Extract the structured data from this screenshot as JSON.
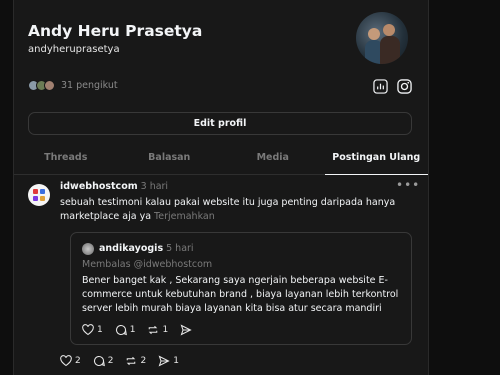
{
  "profile": {
    "name": "Andy Heru Prasetya",
    "handle": "andyheruprasetya",
    "followers": "31 pengikut",
    "edit_label": "Edit profil"
  },
  "tabs": [
    {
      "label": "Threads",
      "active": false
    },
    {
      "label": "Balasan",
      "active": false
    },
    {
      "label": "Media",
      "active": false
    },
    {
      "label": "Postingan Ulang",
      "active": true
    }
  ],
  "post": {
    "username": "idwebhostcom",
    "time": "3 hari",
    "text": "sebuah testimoni kalau pakai website itu juga penting daripada hanya marketplace aja ya",
    "translate": "Terjemahkan",
    "actions": {
      "likes": "2",
      "comments": "2",
      "reposts": "2",
      "shares": "1"
    },
    "quote": {
      "username": "andikayogis",
      "time": "5 hari",
      "reply_to": "Membalas @idwebhostcom",
      "text": "Bener banget kak , Sekarang saya ngerjain beberapa website E-commerce untuk kebutuhan brand , biaya layanan lebih terkontrol server lebih murah biaya layanan kita bisa atur secara mandiri",
      "actions": {
        "likes": "1",
        "comments": "1",
        "reposts": "1"
      }
    }
  },
  "icons": {
    "insights": "bar-chart-icon",
    "instagram": "instagram-icon",
    "more": "more-horizontal-icon",
    "like": "heart-icon",
    "comment": "comment-icon",
    "repost": "repost-icon",
    "share": "send-icon"
  }
}
